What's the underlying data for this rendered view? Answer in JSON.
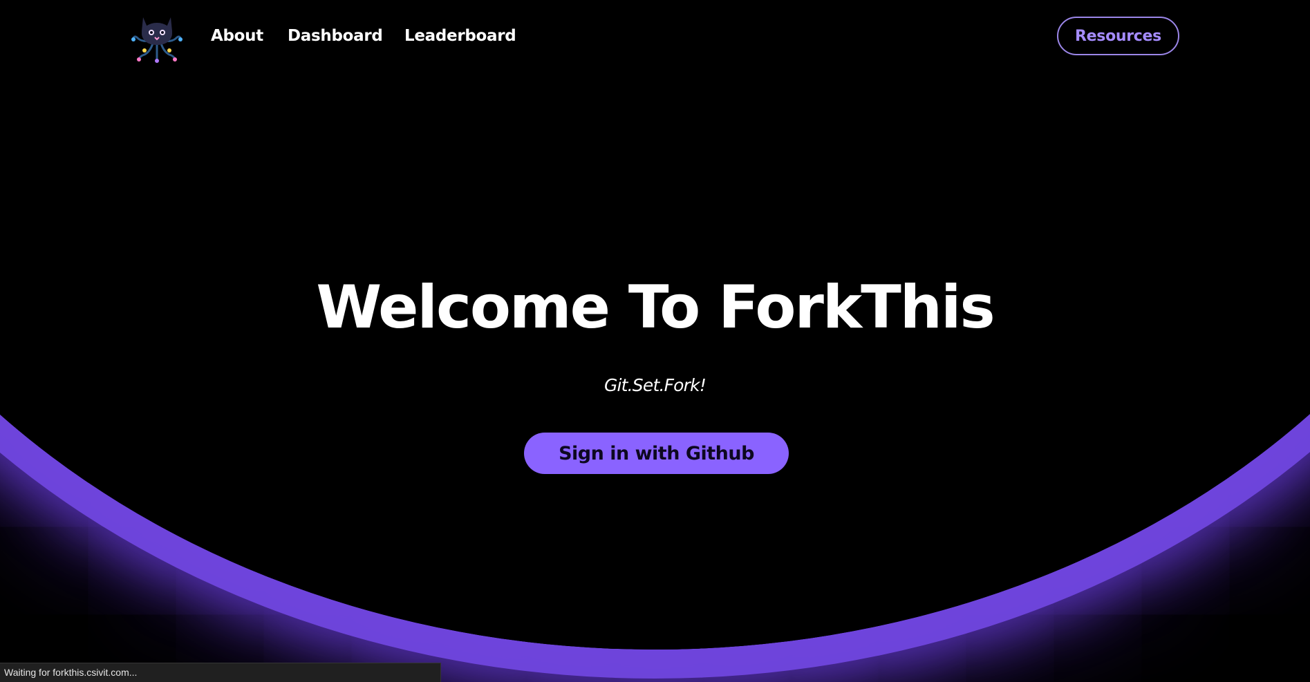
{
  "nav": {
    "logo_icon": "cat-octocat-logo-icon",
    "links": [
      {
        "label": "About"
      },
      {
        "label": "Dashboard"
      },
      {
        "label": "Leaderboard"
      }
    ],
    "resources_label": "Resources"
  },
  "hero": {
    "title": "Welcome To ForkThis",
    "tagline": "Git.Set.Fork!",
    "signin_label": "Sign in with Github"
  },
  "status_bar": {
    "text": "Waiting for forkthis.csivit.com..."
  },
  "colors": {
    "background": "#000000",
    "accent": "#8a63ff",
    "resources_border": "#9b86e8",
    "resources_text": "#a58cff",
    "glow": "#7046de"
  }
}
